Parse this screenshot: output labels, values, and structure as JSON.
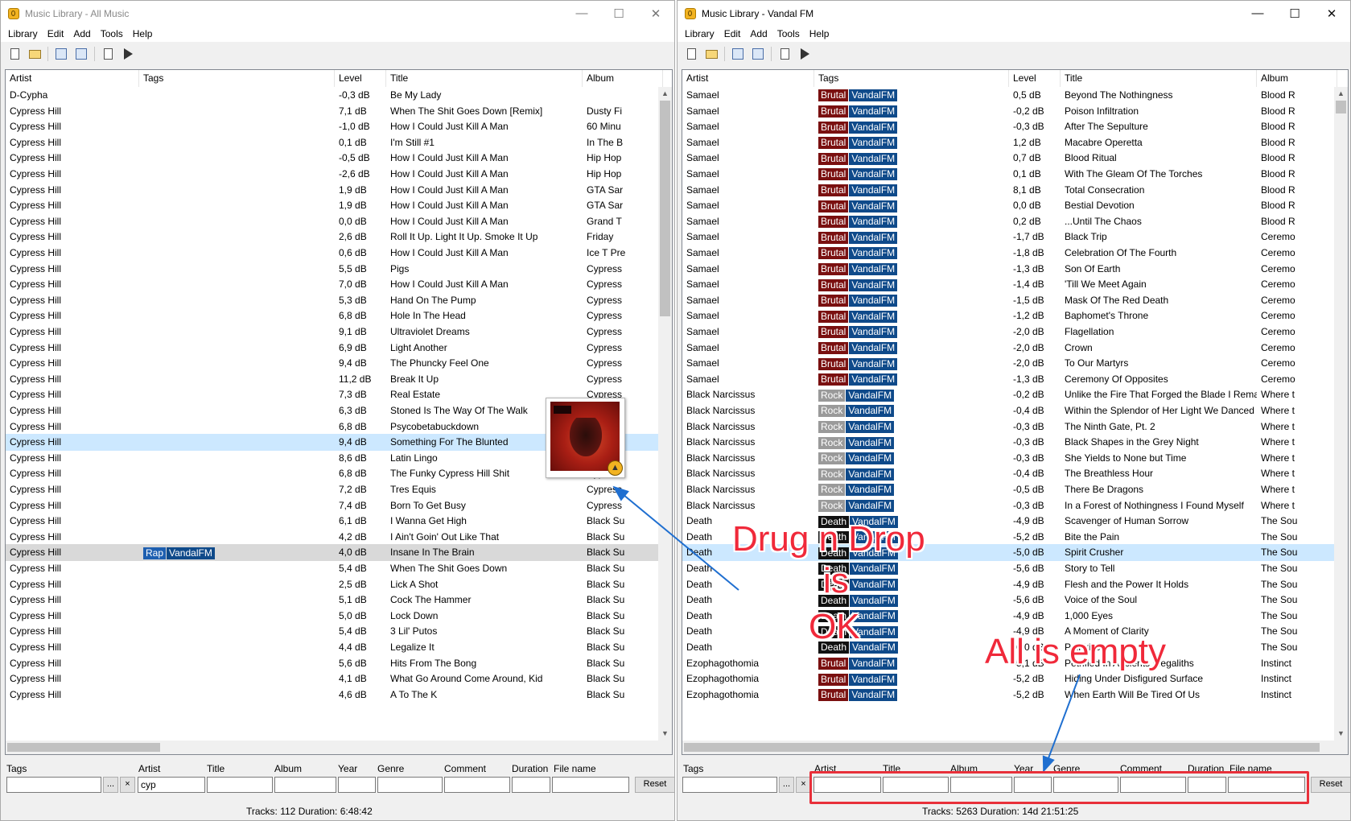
{
  "colors": {
    "tag_brutal": "#7a1010",
    "tag_vandal": "#0f4a8a",
    "tag_rock": "#9a9a9a",
    "tag_death": "#111111",
    "tag_rap": "#1e5fb0",
    "selection": "#cce8ff",
    "annotation": "#f0293a",
    "arrow": "#1f6fd0"
  },
  "left": {
    "title": "Music Library - All Music",
    "menu": [
      "Library",
      "Edit",
      "Add",
      "Tools",
      "Help"
    ],
    "toolbar_icons": [
      "new-icon",
      "open-folder-icon",
      "add-files-icon",
      "add-folder-icon",
      "playlist-icon",
      "play-icon"
    ],
    "columns": [
      "Artist",
      "Tags",
      "Level",
      "Title",
      "Album"
    ],
    "rows": [
      {
        "artist": "D-Cypha",
        "tags": [],
        "level": "-0,3 dB",
        "title": "Be My Lady",
        "album": ""
      },
      {
        "artist": "Cypress Hill",
        "tags": [],
        "level": "7,1 dB",
        "title": "When The Shit Goes Down [Remix]",
        "album": "Dusty Fi"
      },
      {
        "artist": "Cypress Hill",
        "tags": [],
        "level": "-1,0 dB",
        "title": "How I Could Just Kill A Man",
        "album": "60 Minu"
      },
      {
        "artist": "Cypress Hill",
        "tags": [],
        "level": "0,1 dB",
        "title": "I'm Still #1",
        "album": "In The B"
      },
      {
        "artist": "Cypress Hill",
        "tags": [],
        "level": "-0,5 dB",
        "title": "How I Could Just Kill A Man",
        "album": "Hip Hop"
      },
      {
        "artist": "Cypress Hill",
        "tags": [],
        "level": "-2,6 dB",
        "title": "How I Could Just Kill A Man",
        "album": "Hip Hop"
      },
      {
        "artist": "Cypress Hill",
        "tags": [],
        "level": "1,9 dB",
        "title": "How I Could Just Kill A Man",
        "album": "GTA Sar"
      },
      {
        "artist": "Cypress Hill",
        "tags": [],
        "level": "1,9 dB",
        "title": "How I Could Just Kill A Man",
        "album": "GTA Sar"
      },
      {
        "artist": "Cypress Hill",
        "tags": [],
        "level": "0,0 dB",
        "title": "How I Could Just Kill A Man",
        "album": "Grand T"
      },
      {
        "artist": "Cypress Hill",
        "tags": [],
        "level": "2,6 dB",
        "title": "Roll It Up. Light It Up. Smoke It Up",
        "album": "Friday"
      },
      {
        "artist": "Cypress Hill",
        "tags": [],
        "level": "0,6 dB",
        "title": "How I Could Just Kill A Man",
        "album": "Ice T Pre"
      },
      {
        "artist": "Cypress Hill",
        "tags": [],
        "level": "5,5 dB",
        "title": "Pigs",
        "album": "Cypress"
      },
      {
        "artist": "Cypress Hill",
        "tags": [],
        "level": "7,0 dB",
        "title": "How I Could Just Kill A Man",
        "album": "Cypress"
      },
      {
        "artist": "Cypress Hill",
        "tags": [],
        "level": "5,3 dB",
        "title": "Hand On The Pump",
        "album": "Cypress"
      },
      {
        "artist": "Cypress Hill",
        "tags": [],
        "level": "6,8 dB",
        "title": "Hole In The Head",
        "album": "Cypress"
      },
      {
        "artist": "Cypress Hill",
        "tags": [],
        "level": "9,1 dB",
        "title": "Ultraviolet Dreams",
        "album": "Cypress"
      },
      {
        "artist": "Cypress Hill",
        "tags": [],
        "level": "6,9 dB",
        "title": "Light Another",
        "album": "Cypress"
      },
      {
        "artist": "Cypress Hill",
        "tags": [],
        "level": "9,4 dB",
        "title": "The Phuncky Feel One",
        "album": "Cypress"
      },
      {
        "artist": "Cypress Hill",
        "tags": [],
        "level": "11,2 dB",
        "title": "Break It Up",
        "album": "Cypress"
      },
      {
        "artist": "Cypress Hill",
        "tags": [],
        "level": "7,3 dB",
        "title": "Real Estate",
        "album": "Cypress"
      },
      {
        "artist": "Cypress Hill",
        "tags": [],
        "level": "6,3 dB",
        "title": "Stoned Is The Way Of The Walk",
        "album": "Cypress"
      },
      {
        "artist": "Cypress Hill",
        "tags": [],
        "level": "6,8 dB",
        "title": "Psycobetabuckdown",
        "album": "Cypress"
      },
      {
        "artist": "Cypress Hill",
        "tags": [],
        "level": "9,4 dB",
        "title": "Something For The Blunted",
        "album": "Cypress",
        "selected": "blue"
      },
      {
        "artist": "Cypress Hill",
        "tags": [],
        "level": "8,6 dB",
        "title": "Latin Lingo",
        "album": "Cypress"
      },
      {
        "artist": "Cypress Hill",
        "tags": [],
        "level": "6,8 dB",
        "title": "The Funky Cypress Hill Shit",
        "album": "Cypress"
      },
      {
        "artist": "Cypress Hill",
        "tags": [],
        "level": "7,2 dB",
        "title": "Tres Equis",
        "album": "Cypress"
      },
      {
        "artist": "Cypress Hill",
        "tags": [],
        "level": "7,4 dB",
        "title": "Born To Get Busy",
        "album": "Cypress"
      },
      {
        "artist": "Cypress Hill",
        "tags": [],
        "level": "6,1 dB",
        "title": "I Wanna Get High",
        "album": "Black Su"
      },
      {
        "artist": "Cypress Hill",
        "tags": [],
        "level": "4,2 dB",
        "title": "I Ain't Goin' Out Like That",
        "album": "Black Su"
      },
      {
        "artist": "Cypress Hill",
        "tags": [
          "Rap",
          "VandalFM"
        ],
        "level": "4,0 dB",
        "title": "Insane In The Brain",
        "album": "Black Su",
        "selected": "gray"
      },
      {
        "artist": "Cypress Hill",
        "tags": [],
        "level": "5,4 dB",
        "title": "When The Shit Goes Down",
        "album": "Black Su"
      },
      {
        "artist": "Cypress Hill",
        "tags": [],
        "level": "2,5 dB",
        "title": "Lick A Shot",
        "album": "Black Su"
      },
      {
        "artist": "Cypress Hill",
        "tags": [],
        "level": "5,1 dB",
        "title": "Cock The Hammer",
        "album": "Black Su"
      },
      {
        "artist": "Cypress Hill",
        "tags": [],
        "level": "5,0 dB",
        "title": "Lock Down",
        "album": "Black Su"
      },
      {
        "artist": "Cypress Hill",
        "tags": [],
        "level": "5,4 dB",
        "title": "3 Lil' Putos",
        "album": "Black Su"
      },
      {
        "artist": "Cypress Hill",
        "tags": [],
        "level": "4,4 dB",
        "title": "Legalize It",
        "album": "Black Su"
      },
      {
        "artist": "Cypress Hill",
        "tags": [],
        "level": "5,6 dB",
        "title": "Hits From The Bong",
        "album": "Black Su"
      },
      {
        "artist": "Cypress Hill",
        "tags": [],
        "level": "4,1 dB",
        "title": "What Go Around Come Around, Kid",
        "album": "Black Su"
      },
      {
        "artist": "Cypress Hill",
        "tags": [],
        "level": "4,6 dB",
        "title": "A To The K",
        "album": "Black Su"
      }
    ],
    "filter_labels": [
      "Tags",
      "Artist",
      "Title",
      "Album",
      "Year",
      "Genre",
      "Comment",
      "Duration",
      "File name"
    ],
    "filter_values": {
      "tags": "",
      "artist": "cyp",
      "title": "",
      "album": "",
      "year": "",
      "genre": "",
      "comment": "",
      "duration": "",
      "filename": ""
    },
    "more_button": "...",
    "clear_button": "×",
    "reset_button": "Reset",
    "status": "Tracks: 112 Duration: 6:48:42"
  },
  "right": {
    "title": "Music Library - Vandal FM",
    "menu": [
      "Library",
      "Edit",
      "Add",
      "Tools",
      "Help"
    ],
    "toolbar_icons": [
      "new-icon",
      "open-folder-icon",
      "add-files-icon",
      "add-folder-icon",
      "playlist-icon",
      "play-icon"
    ],
    "columns": [
      "Artist",
      "Tags",
      "Level",
      "Title",
      "Album"
    ],
    "rows": [
      {
        "artist": "Samael",
        "tags": [
          "Brutal",
          "VandalFM"
        ],
        "level": "0,5 dB",
        "title": "Beyond The Nothingness",
        "album": "Blood R"
      },
      {
        "artist": "Samael",
        "tags": [
          "Brutal",
          "VandalFM"
        ],
        "level": "-0,2 dB",
        "title": "Poison Infiltration",
        "album": "Blood R"
      },
      {
        "artist": "Samael",
        "tags": [
          "Brutal",
          "VandalFM"
        ],
        "level": "-0,3 dB",
        "title": "After The Sepulture",
        "album": "Blood R"
      },
      {
        "artist": "Samael",
        "tags": [
          "Brutal",
          "VandalFM"
        ],
        "level": "1,2 dB",
        "title": "Macabre Operetta",
        "album": "Blood R"
      },
      {
        "artist": "Samael",
        "tags": [
          "Brutal",
          "VandalFM"
        ],
        "level": "0,7 dB",
        "title": "Blood Ritual",
        "album": "Blood R"
      },
      {
        "artist": "Samael",
        "tags": [
          "Brutal",
          "VandalFM"
        ],
        "level": "0,1 dB",
        "title": "With The Gleam Of The Torches",
        "album": "Blood R"
      },
      {
        "artist": "Samael",
        "tags": [
          "Brutal",
          "VandalFM"
        ],
        "level": "8,1 dB",
        "title": "Total Consecration",
        "album": "Blood R"
      },
      {
        "artist": "Samael",
        "tags": [
          "Brutal",
          "VandalFM"
        ],
        "level": "0,0 dB",
        "title": "Bestial Devotion",
        "album": "Blood R"
      },
      {
        "artist": "Samael",
        "tags": [
          "Brutal",
          "VandalFM"
        ],
        "level": "0,2 dB",
        "title": "...Until The Chaos",
        "album": "Blood R"
      },
      {
        "artist": "Samael",
        "tags": [
          "Brutal",
          "VandalFM"
        ],
        "level": "-1,7 dB",
        "title": "Black Trip",
        "album": "Ceremo"
      },
      {
        "artist": "Samael",
        "tags": [
          "Brutal",
          "VandalFM"
        ],
        "level": "-1,8 dB",
        "title": "Celebration Of The Fourth",
        "album": "Ceremo"
      },
      {
        "artist": "Samael",
        "tags": [
          "Brutal",
          "VandalFM"
        ],
        "level": "-1,3 dB",
        "title": "Son Of Earth",
        "album": "Ceremo"
      },
      {
        "artist": "Samael",
        "tags": [
          "Brutal",
          "VandalFM"
        ],
        "level": "-1,4 dB",
        "title": "'Till We Meet Again",
        "album": "Ceremo"
      },
      {
        "artist": "Samael",
        "tags": [
          "Brutal",
          "VandalFM"
        ],
        "level": "-1,5 dB",
        "title": "Mask Of The Red Death",
        "album": "Ceremo"
      },
      {
        "artist": "Samael",
        "tags": [
          "Brutal",
          "VandalFM"
        ],
        "level": "-1,2 dB",
        "title": "Baphomet's Throne",
        "album": "Ceremo"
      },
      {
        "artist": "Samael",
        "tags": [
          "Brutal",
          "VandalFM"
        ],
        "level": "-2,0 dB",
        "title": "Flagellation",
        "album": "Ceremo"
      },
      {
        "artist": "Samael",
        "tags": [
          "Brutal",
          "VandalFM"
        ],
        "level": "-2,0 dB",
        "title": "Crown",
        "album": "Ceremo"
      },
      {
        "artist": "Samael",
        "tags": [
          "Brutal",
          "VandalFM"
        ],
        "level": "-2,0 dB",
        "title": "To Our Martyrs",
        "album": "Ceremo"
      },
      {
        "artist": "Samael",
        "tags": [
          "Brutal",
          "VandalFM"
        ],
        "level": "-1,3 dB",
        "title": "Ceremony Of Opposites",
        "album": "Ceremo"
      },
      {
        "artist": "Black Narcissus",
        "tags": [
          "Rock",
          "VandalFM"
        ],
        "level": "-0,2 dB",
        "title": "Unlike the Fire That Forged the Blade I Remain ...",
        "album": "Where t"
      },
      {
        "artist": "Black Narcissus",
        "tags": [
          "Rock",
          "VandalFM"
        ],
        "level": "-0,4 dB",
        "title": "Within the Splendor of Her Light We Danced E...",
        "album": "Where t"
      },
      {
        "artist": "Black Narcissus",
        "tags": [
          "Rock",
          "VandalFM"
        ],
        "level": "-0,3 dB",
        "title": "The Ninth Gate, Pt. 2",
        "album": "Where t"
      },
      {
        "artist": "Black Narcissus",
        "tags": [
          "Rock",
          "VandalFM"
        ],
        "level": "-0,3 dB",
        "title": "Black Shapes in the Grey Night",
        "album": "Where t"
      },
      {
        "artist": "Black Narcissus",
        "tags": [
          "Rock",
          "VandalFM"
        ],
        "level": "-0,3 dB",
        "title": "She Yields to None but Time",
        "album": "Where t"
      },
      {
        "artist": "Black Narcissus",
        "tags": [
          "Rock",
          "VandalFM"
        ],
        "level": "-0,4 dB",
        "title": "The Breathless Hour",
        "album": "Where t"
      },
      {
        "artist": "Black Narcissus",
        "tags": [
          "Rock",
          "VandalFM"
        ],
        "level": "-0,5 dB",
        "title": "There Be Dragons",
        "album": "Where t"
      },
      {
        "artist": "Black Narcissus",
        "tags": [
          "Rock",
          "VandalFM"
        ],
        "level": "-0,3 dB",
        "title": "In a Forest of Nothingness I Found Myself",
        "album": "Where t"
      },
      {
        "artist": "Death",
        "tags": [
          "Death",
          "VandalFM"
        ],
        "level": "-4,9 dB",
        "title": "Scavenger of Human Sorrow",
        "album": "The Sou"
      },
      {
        "artist": "Death",
        "tags": [
          "Death",
          "VandalFM"
        ],
        "level": "-5,2 dB",
        "title": "Bite the Pain",
        "album": "The Sou"
      },
      {
        "artist": "Death",
        "tags": [
          "Death",
          "VandalFM"
        ],
        "level": "-5,0 dB",
        "title": "Spirit Crusher",
        "album": "The Sou",
        "selected": "blue"
      },
      {
        "artist": "Death",
        "tags": [
          "Death",
          "VandalFM"
        ],
        "level": "-5,6 dB",
        "title": "Story to Tell",
        "album": "The Sou"
      },
      {
        "artist": "Death",
        "tags": [
          "Death",
          "VandalFM"
        ],
        "level": "-4,9 dB",
        "title": "Flesh and the Power It Holds",
        "album": "The Sou"
      },
      {
        "artist": "Death",
        "tags": [
          "Death",
          "VandalFM"
        ],
        "level": "-5,6 dB",
        "title": "Voice of the Soul",
        "album": "The Sou"
      },
      {
        "artist": "Death",
        "tags": [
          "Death",
          "VandalFM"
        ],
        "level": "-4,9 dB",
        "title": "1,000 Eyes",
        "album": "The Sou"
      },
      {
        "artist": "Death",
        "tags": [
          "Death",
          "VandalFM"
        ],
        "level": "-4,9 dB",
        "title": "A Moment of Clarity",
        "album": "The Sou"
      },
      {
        "artist": "Death",
        "tags": [
          "Death",
          "VandalFM"
        ],
        "level": "-6,0 dB",
        "title": "Painkiller",
        "album": "The Sou"
      },
      {
        "artist": "Ezophagothomia",
        "tags": [
          "Brutal",
          "VandalFM"
        ],
        "level": "-5,1 dB",
        "title": "Petrified In Ancients Megaliths",
        "album": "Instinct"
      },
      {
        "artist": "Ezophagothomia",
        "tags": [
          "Brutal",
          "VandalFM"
        ],
        "level": "-5,2 dB",
        "title": "Hiding Under Disfigured Surface",
        "album": "Instinct"
      },
      {
        "artist": "Ezophagothomia",
        "tags": [
          "Brutal",
          "VandalFM"
        ],
        "level": "-5,2 dB",
        "title": "When Earth Will Be Tired Of Us",
        "album": "Instinct"
      }
    ],
    "filter_labels": [
      "Tags",
      "Artist",
      "Title",
      "Album",
      "Year",
      "Genre",
      "Comment",
      "Duration",
      "File name"
    ],
    "filter_values": {
      "tags": "",
      "artist": "",
      "title": "",
      "album": "",
      "year": "",
      "genre": "",
      "comment": "",
      "duration": "",
      "filename": ""
    },
    "more_button": "...",
    "clear_button": "×",
    "reset_button": "Reset",
    "status": "Tracks: 5263 Duration: 14d 21:51:25"
  },
  "annotations": {
    "drag_line1": "Drug n Drop",
    "drag_line2": "is",
    "drag_line3": "OK",
    "empty": "All is empty"
  },
  "caption_buttons": {
    "minimize": "—",
    "maximize": "☐",
    "close": "✕"
  }
}
